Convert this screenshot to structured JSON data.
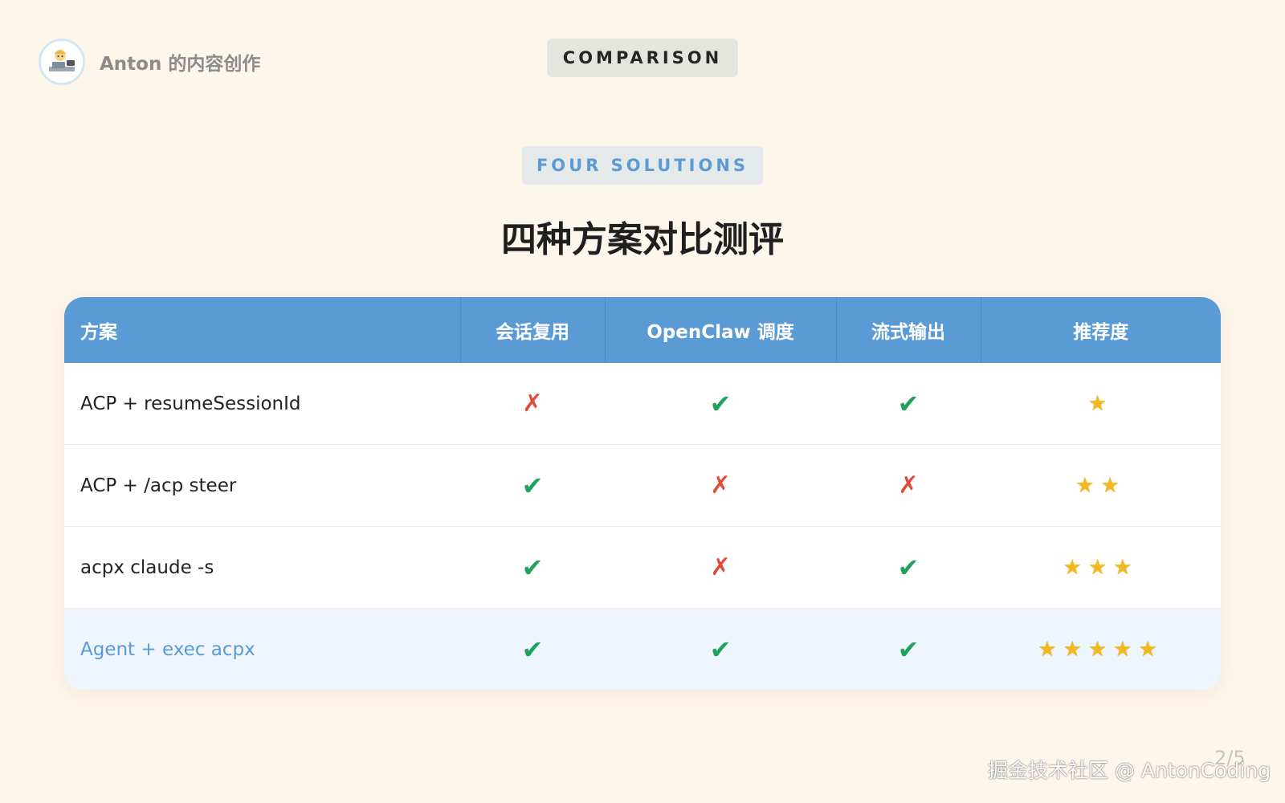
{
  "author": {
    "name": "Anton 的内容创作",
    "avatar_icon": "cartoon-avatar-icon"
  },
  "badge_top": "COMPARISON",
  "badge_sub": "FOUR SOLUTIONS",
  "title": "四种方案对比测评",
  "table": {
    "headers": [
      "方案",
      "会话复用",
      "OpenClaw 调度",
      "流式输出",
      "推荐度"
    ],
    "rows": [
      {
        "name": "ACP + resumeSessionId",
        "session_reuse": "✗",
        "openclaw": "✔",
        "streaming": "✔",
        "rating": "★",
        "rating_value": 1
      },
      {
        "name": "ACP + /acp steer",
        "session_reuse": "✔",
        "openclaw": "✗",
        "streaming": "✗",
        "rating": "★★",
        "rating_value": 2
      },
      {
        "name": "acpx claude -s",
        "session_reuse": "✔",
        "openclaw": "✗",
        "streaming": "✔",
        "rating": "★★★",
        "rating_value": 3
      },
      {
        "name": "Agent + exec acpx",
        "session_reuse": "✔",
        "openclaw": "✔",
        "streaming": "✔",
        "rating": "★★★★★",
        "rating_value": 5
      }
    ]
  },
  "page_number": "2/5",
  "watermark": "掘金技术社区 @ AntonCoding",
  "colors": {
    "background": "#fdf6ea",
    "header_blue": "#5b9bd5",
    "check_green": "#1fa35c",
    "cross_red": "#e24b3b",
    "star_gold": "#f2b81f",
    "highlight_row": "#eef5fc"
  }
}
